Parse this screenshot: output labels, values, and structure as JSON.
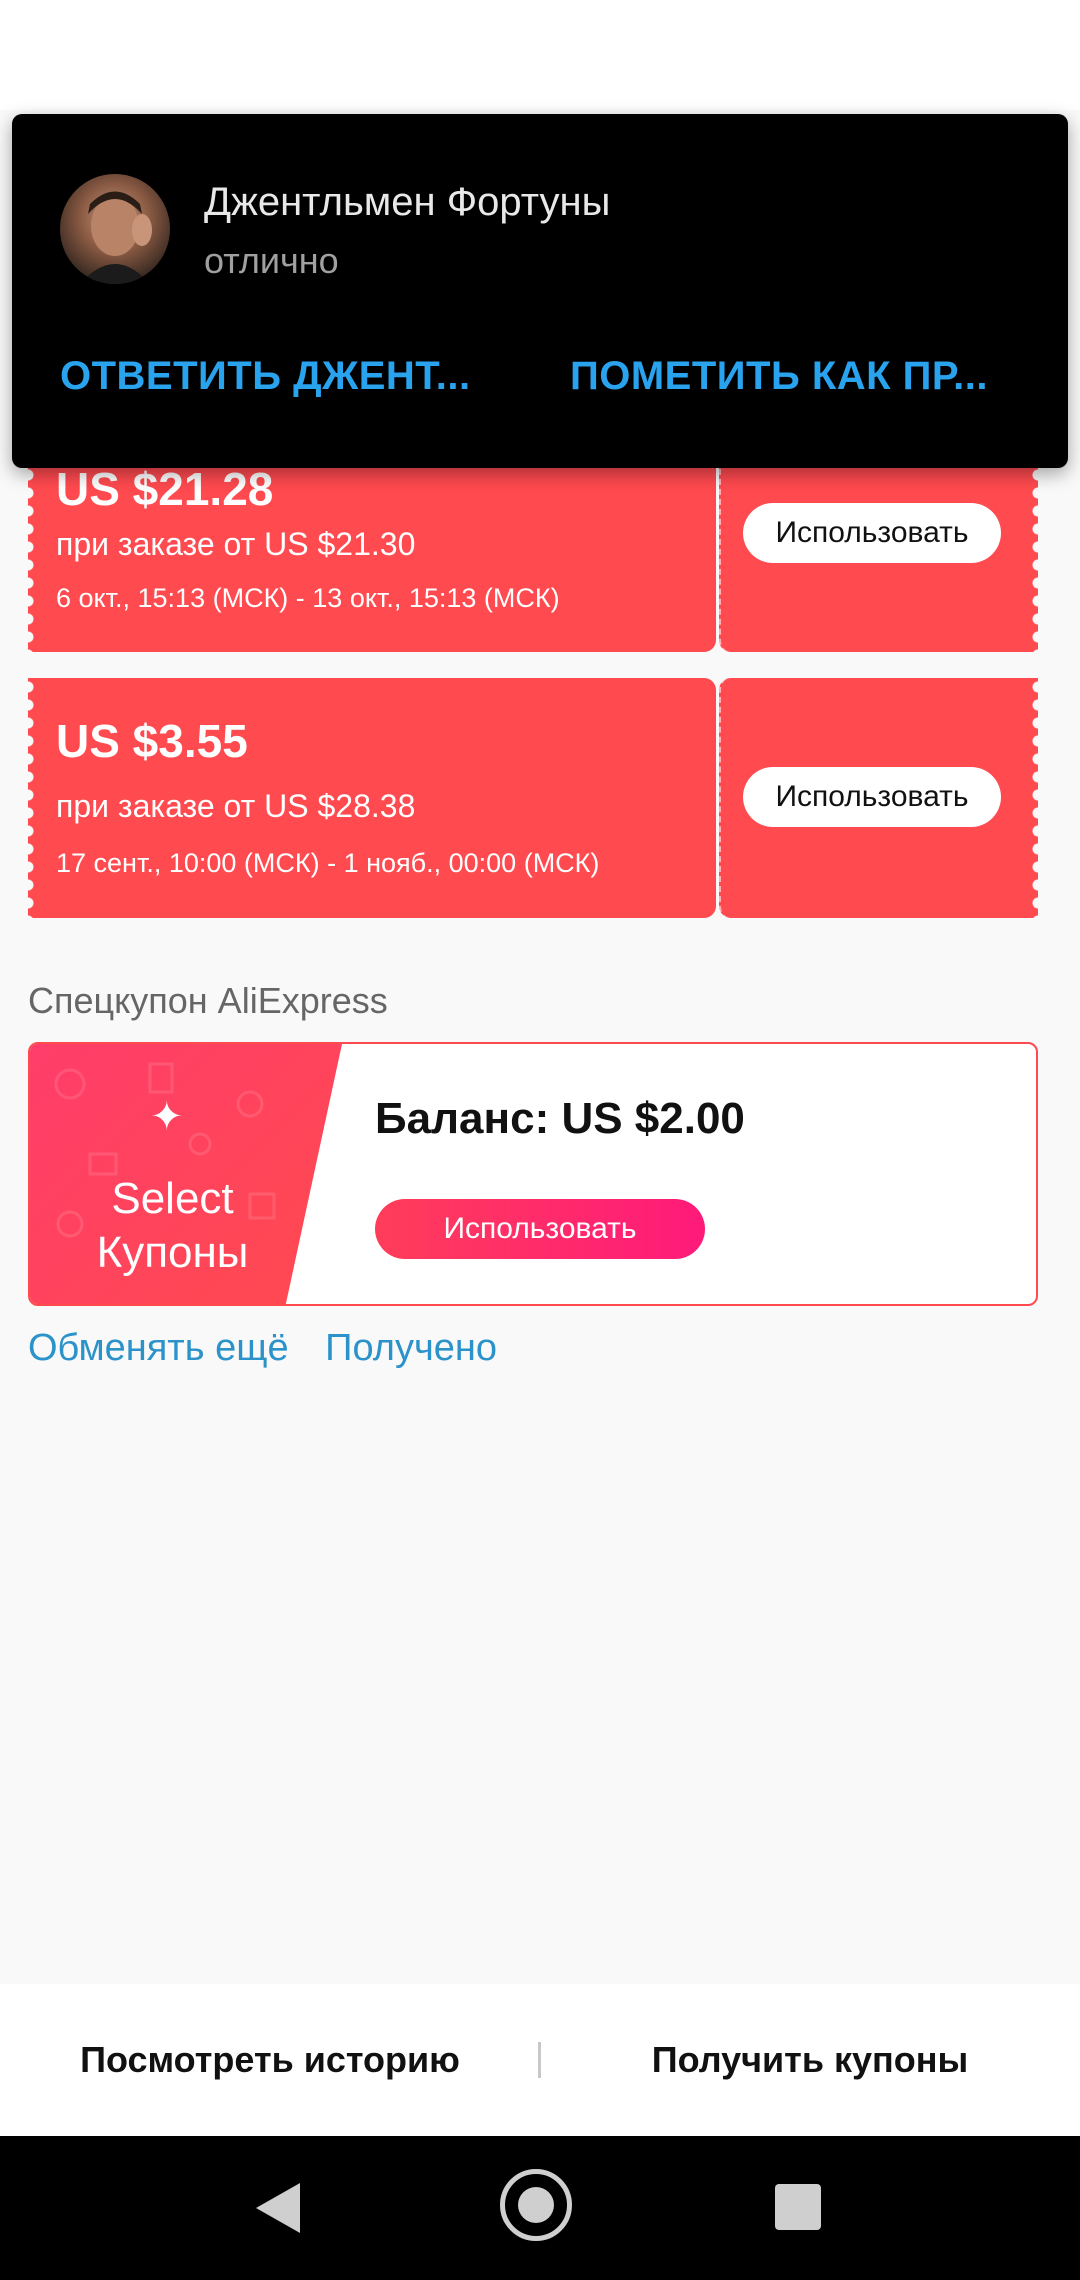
{
  "notification": {
    "sender": "Джентльмен Фортуны",
    "message": "отлично",
    "actions": [
      "ОТВЕТИТЬ ДЖЕНТ...",
      "ПОМЕТИТЬ КАК ПР..."
    ]
  },
  "coupons": [
    {
      "amount": "US $21.28",
      "min_order": "при заказе от US $21.30",
      "validity": "6 окт., 15:13 (МСК) - 13 окт., 15:13 (МСК)",
      "button": "Использовать"
    },
    {
      "amount": "US $3.55",
      "min_order": "при заказе от US $28.38",
      "validity": "17 сент., 10:00 (МСК) - 1 нояб., 00:00 (МСК)",
      "button": "Использовать"
    }
  ],
  "special_coupon": {
    "section_title": "Спецкупон AliExpress",
    "banner_line1": "Select",
    "banner_line2": "Купоны",
    "balance": "Баланс: US $2.00",
    "button": "Использовать",
    "links": [
      "Обменять ещё",
      "Получено"
    ]
  },
  "bottom_bar": {
    "history": "Посмотреть историю",
    "get_coupons": "Получить купоны"
  },
  "colors": {
    "coupon_red": "#ff4a4f",
    "link_blue": "#2b93c9",
    "notif_action_blue": "#2aa3ef"
  }
}
